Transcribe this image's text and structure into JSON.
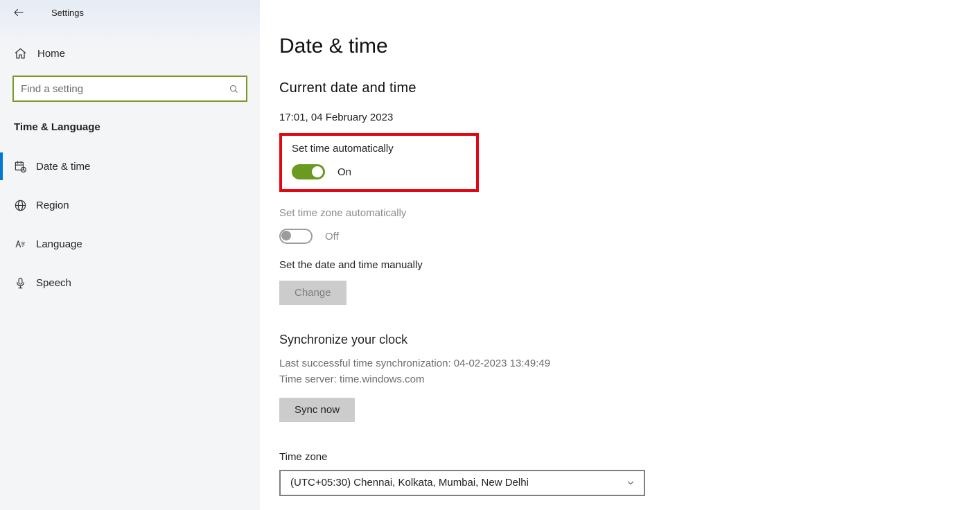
{
  "titlebar": {
    "title": "Settings"
  },
  "sidebar": {
    "home_label": "Home",
    "search_placeholder": "Find a setting",
    "section_title": "Time & Language",
    "items": [
      {
        "label": "Date & time"
      },
      {
        "label": "Region"
      },
      {
        "label": "Language"
      },
      {
        "label": "Speech"
      }
    ]
  },
  "main": {
    "title": "Date & time",
    "current_heading": "Current date and time",
    "current_value": "17:01, 04 February 2023",
    "auto_time": {
      "label": "Set time automatically",
      "state_label": "On",
      "on": true
    },
    "auto_tz": {
      "label": "Set time zone automatically",
      "state_label": "Off",
      "on": false
    },
    "manual": {
      "label": "Set the date and time manually",
      "button": "Change"
    },
    "sync": {
      "heading": "Synchronize your clock",
      "last_sync": "Last successful time synchronization: 04-02-2023 13:49:49",
      "server": "Time server: time.windows.com",
      "button": "Sync now"
    },
    "timezone": {
      "label": "Time zone",
      "selected": "(UTC+05:30) Chennai, Kolkata, Mumbai, New Delhi"
    }
  }
}
